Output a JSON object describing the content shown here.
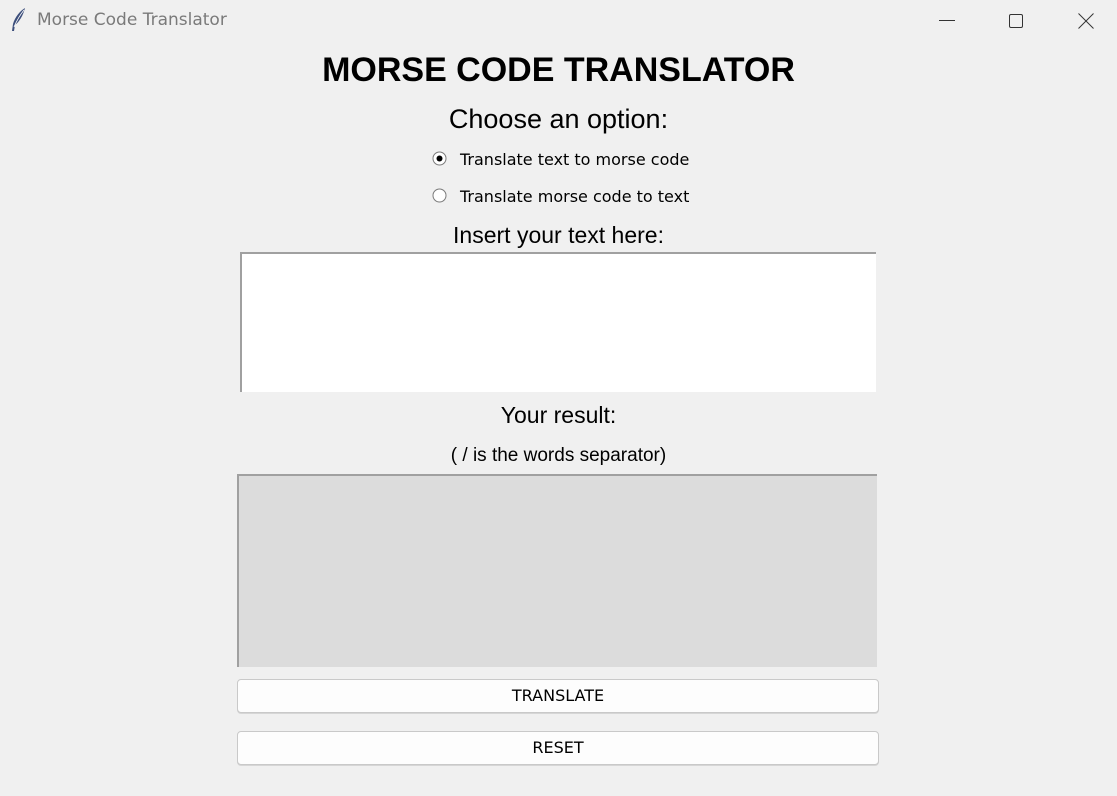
{
  "window": {
    "title": "Morse Code Translator"
  },
  "heading": "MORSE CODE TRANSLATOR",
  "options": {
    "prompt": "Choose an option:",
    "items": [
      {
        "label": "Translate text to morse code",
        "selected": true
      },
      {
        "label": "Translate morse code to text",
        "selected": false
      }
    ]
  },
  "input": {
    "label": "Insert your text here:",
    "value": ""
  },
  "result": {
    "label": "Your result:",
    "note": "( / is the words separator)",
    "value": ""
  },
  "buttons": {
    "translate": "TRANSLATE",
    "reset": "RESET"
  },
  "icons": {
    "app": "feather-icon",
    "minimize": "minimize-icon",
    "maximize": "maximize-icon",
    "close": "close-icon"
  }
}
